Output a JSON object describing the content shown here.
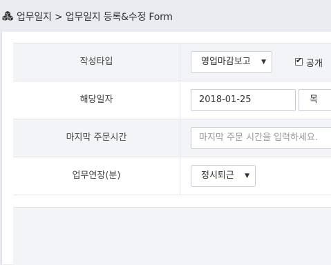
{
  "header": {
    "icon": "cubes-icon",
    "breadcrumb": "업무일지 > 업무일지 등록&수정 Form"
  },
  "form": {
    "rows": [
      {
        "label": "작성타입",
        "select_value": "영업마감보고",
        "checkbox_checked": true,
        "checkbox_label": "공개"
      },
      {
        "label": "해당일자",
        "date_value": "2018-01-25",
        "weekday_value": "목"
      },
      {
        "label": "마지막 주문시간",
        "input_placeholder": "마지막 주문 시간을 입력하세요."
      },
      {
        "label": "업무연장(분)",
        "select_value": "정시퇴근"
      }
    ]
  },
  "colors": {
    "background": "#e9ebf0",
    "row_shade": "#f2f4f7",
    "border": "#e2e4e8"
  }
}
